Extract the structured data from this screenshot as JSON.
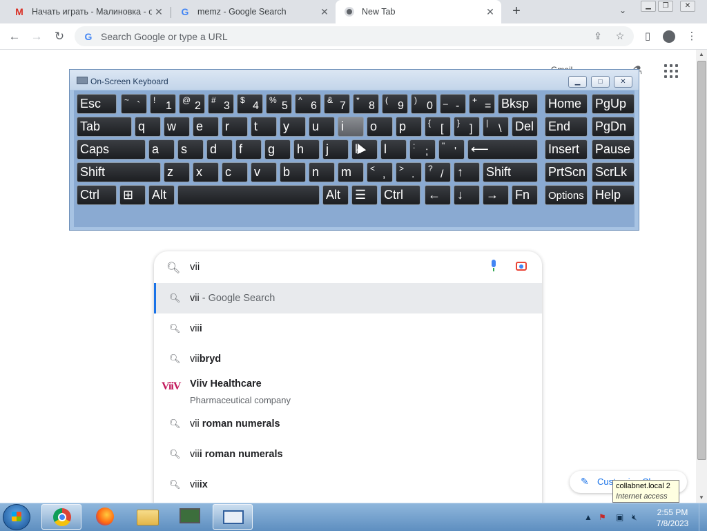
{
  "browser": {
    "tabs": [
      {
        "title": "Начать играть - Малиновка - о",
        "favicon": "gmail-m-icon"
      },
      {
        "title": "memz - Google Search",
        "favicon": "google-icon"
      },
      {
        "title": "New Tab",
        "favicon": "chrome-icon",
        "active": true
      }
    ],
    "omnibox_placeholder": "Search Google or type a URL"
  },
  "ntp": {
    "gmail_peek": "Gmail",
    "customize_label": "Customize Chrome"
  },
  "osk": {
    "title": "On-Screen Keyboard",
    "rows": [
      [
        {
          "m": "Esc"
        },
        {
          "hi": "~",
          "lo": "`"
        },
        {
          "hi": "!",
          "lo": "1"
        },
        {
          "hi": "@",
          "lo": "2"
        },
        {
          "hi": "#",
          "lo": "3"
        },
        {
          "hi": "$",
          "lo": "4"
        },
        {
          "hi": "%",
          "lo": "5"
        },
        {
          "hi": "^",
          "lo": "6"
        },
        {
          "hi": "&",
          "lo": "7"
        },
        {
          "hi": "*",
          "lo": "8"
        },
        {
          "hi": "(",
          "lo": "9"
        },
        {
          "hi": ")",
          "lo": "0"
        },
        {
          "hi": "_",
          "lo": "-"
        },
        {
          "hi": "+",
          "lo": "="
        },
        {
          "m": "Bksp"
        },
        {
          "m": "Home"
        },
        {
          "m": "PgUp"
        }
      ],
      [
        {
          "m": "Tab"
        },
        {
          "m": "q"
        },
        {
          "m": "w"
        },
        {
          "m": "e"
        },
        {
          "m": "r"
        },
        {
          "m": "t"
        },
        {
          "m": "y"
        },
        {
          "m": "u"
        },
        {
          "m": "i"
        },
        {
          "m": "o"
        },
        {
          "m": "p"
        },
        {
          "hi": "{",
          "lo": "["
        },
        {
          "hi": "}",
          "lo": "]"
        },
        {
          "hi": "|",
          "lo": "\\"
        },
        {
          "m": "Del"
        },
        {
          "m": "End"
        },
        {
          "m": "PgDn"
        }
      ],
      [
        {
          "m": "Caps"
        },
        {
          "m": "a"
        },
        {
          "m": "s"
        },
        {
          "m": "d"
        },
        {
          "m": "f"
        },
        {
          "m": "g"
        },
        {
          "m": "h"
        },
        {
          "m": "j"
        },
        {
          "m": "k"
        },
        {
          "m": "l"
        },
        {
          "hi": ":",
          "lo": ";"
        },
        {
          "hi": "\"",
          "lo": "'"
        },
        {
          "m": "⟵"
        },
        {
          "m": "Insert"
        },
        {
          "m": "Pause"
        }
      ],
      [
        {
          "m": "Shift"
        },
        {
          "m": "z"
        },
        {
          "m": "x"
        },
        {
          "m": "c"
        },
        {
          "m": "v"
        },
        {
          "m": "b"
        },
        {
          "m": "n"
        },
        {
          "m": "m"
        },
        {
          "hi": "<",
          "lo": ","
        },
        {
          "hi": ">",
          "lo": "."
        },
        {
          "hi": "?",
          "lo": "/"
        },
        {
          "m": "↑"
        },
        {
          "m": "Shift"
        },
        {
          "m": "PrtScn"
        },
        {
          "m": "ScrLk"
        }
      ],
      [
        {
          "m": "Ctrl"
        },
        {
          "m": "⊞"
        },
        {
          "m": "Alt"
        },
        {
          "m": ""
        },
        {
          "m": "Alt"
        },
        {
          "m": "☰"
        },
        {
          "m": "Ctrl"
        },
        {
          "m": "←"
        },
        {
          "m": "↓"
        },
        {
          "m": "→"
        },
        {
          "m": "Fn"
        },
        {
          "m": "Options"
        },
        {
          "m": "Help"
        }
      ]
    ]
  },
  "search": {
    "query": "vii",
    "suggestions": [
      {
        "prefix": "vii",
        "rest": " - Google Search",
        "rest_style": "gray",
        "selected": true
      },
      {
        "prefix": "vii",
        "rest": "i"
      },
      {
        "prefix": "vii",
        "rest": "bryd"
      },
      {
        "prefix": "Viiv",
        "rest": " Healthcare",
        "sub": "Pharmaceutical company",
        "logo": "ViiV"
      },
      {
        "prefix": "vii",
        "rest": " roman numerals"
      },
      {
        "prefix": "vii",
        "rest": "i roman numerals"
      },
      {
        "prefix": "vii",
        "rest": "ix"
      }
    ]
  },
  "tooltip": {
    "line1": "collabnet.local  2",
    "line2": "Internet access"
  },
  "taskbar": {
    "time": "2:55 PM",
    "date": "7/8/2023"
  }
}
